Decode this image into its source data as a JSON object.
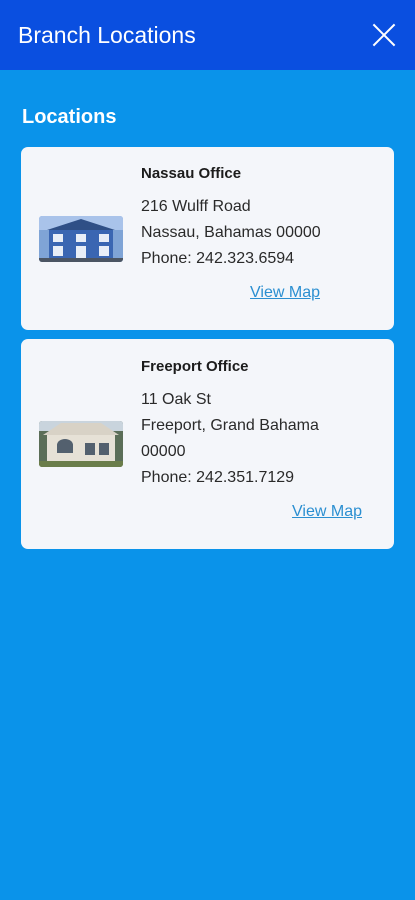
{
  "header": {
    "title": "Branch Locations"
  },
  "section_title": "Locations",
  "locations": [
    {
      "name": "Nassau Office",
      "address1": "216 Wulff Road",
      "address2": "Nassau, Bahamas 00000",
      "phone": "Phone: 242.323.6594",
      "map_label": "View Map"
    },
    {
      "name": "Freeport Office",
      "address1": "11 Oak St",
      "address2": "Freeport, Grand Bahama 00000",
      "phone": "Phone: 242.351.7129",
      "map_label": "View Map"
    }
  ]
}
